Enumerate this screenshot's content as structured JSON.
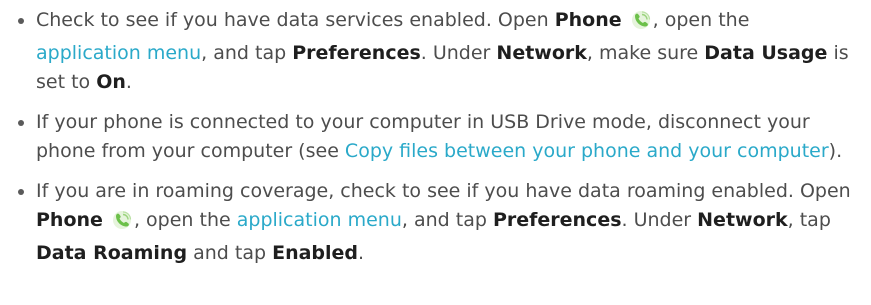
{
  "items": [
    {
      "segments": [
        "Check to see if you have data services enabled. Open ",
        "Phone",
        ", open the ",
        "application menu",
        ", and tap ",
        "Preferences",
        ". Under ",
        "Network",
        ", make sure ",
        "Data Usage",
        " is set to ",
        "On",
        "."
      ]
    },
    {
      "segments": [
        "If your phone is connected to your computer in USB Drive mode, disconnect your phone from your computer (see ",
        "Copy files between your phone and your computer",
        ")."
      ]
    },
    {
      "segments": [
        "If you are in roaming coverage, check to see if you have data roaming enabled. Open ",
        "Phone",
        ", open the ",
        "application menu",
        ", and tap ",
        "Preferences",
        ". Under ",
        "Network",
        ", tap ",
        "Data Roaming",
        " and tap ",
        "Enabled",
        "."
      ]
    }
  ],
  "icons": {
    "phone": "phone-app-icon"
  },
  "colors": {
    "body_text": "#4d4d4d",
    "bold_text": "#1f1f1f",
    "link": "#2aa9c9",
    "icon_green": "#6cc04a"
  }
}
